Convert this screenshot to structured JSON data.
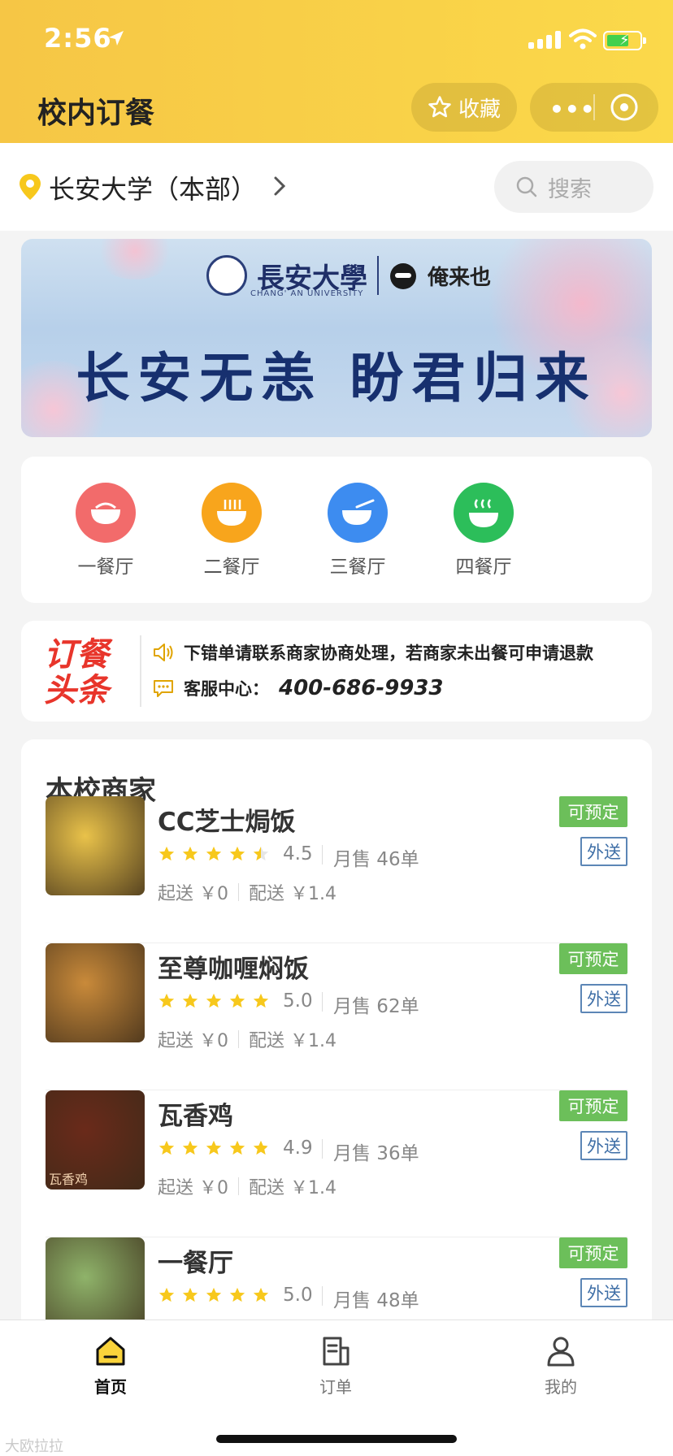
{
  "status_bar": {
    "time": "2:56"
  },
  "header": {
    "title": "校内订餐",
    "favorite_label": "收藏",
    "more_label": "•••"
  },
  "location": {
    "campus": "长安大学（本部）",
    "search_placeholder": "搜索"
  },
  "banner": {
    "university": "長安大學",
    "university_en": "CHANG' AN UNIVERSITY",
    "brand": "俺来也",
    "headline": "长安无恙 盼君归来"
  },
  "canteens": [
    {
      "label": "一餐厅",
      "color": "#f26b6b",
      "icon": "rice-bowl-icon"
    },
    {
      "label": "二餐厅",
      "color": "#f8a51c",
      "icon": "noodle-bowl-icon"
    },
    {
      "label": "三餐厅",
      "color": "#3d8cf0",
      "icon": "soup-bowl-icon"
    },
    {
      "label": "四餐厅",
      "color": "#2cbe5a",
      "icon": "hot-bowl-icon"
    }
  ],
  "notice": {
    "badge_line1": "订餐",
    "badge_line2": "头条",
    "message": "下错单请联系商家协商处理，若商家未出餐可申请退款",
    "service_label": "客服中心：",
    "service_phone": "400-686-9933"
  },
  "merchants": {
    "title": "本校商家",
    "shops": [
      {
        "name": "CC芝士焗饭",
        "rating": "4.5",
        "rating_value": 4.5,
        "sales": "月售 46单",
        "min_order": "起送 ￥0",
        "delivery_fee": "配送 ￥1.4",
        "tag_reserve": "可预定",
        "tag_delivery": "外送",
        "thumb_color": "#e9c24a"
      },
      {
        "name": "至尊咖喱焖饭",
        "rating": "5.0",
        "rating_value": 5.0,
        "sales": "月售 62单",
        "min_order": "起送 ￥0",
        "delivery_fee": "配送 ￥1.4",
        "tag_reserve": "可预定",
        "tag_delivery": "外送",
        "thumb_color": "#c98a3a"
      },
      {
        "name": "瓦香鸡",
        "rating": "4.9",
        "rating_value": 4.9,
        "sales": "月售 36单",
        "min_order": "起送 ￥0",
        "delivery_fee": "配送 ￥1.4",
        "tag_reserve": "可预定",
        "tag_delivery": "外送",
        "thumb_color": "#6a2a1a",
        "thumb_caption": "瓦香鸡"
      },
      {
        "name": "一餐厅",
        "rating": "5.0",
        "rating_value": 5.0,
        "sales": "月售 48单",
        "min_order": "",
        "delivery_fee": "",
        "tag_reserve": "可预定",
        "tag_delivery": "外送",
        "thumb_color": "#8fb36a"
      }
    ]
  },
  "tabbar": {
    "tabs": [
      {
        "label": "首页",
        "active": true
      },
      {
        "label": "订单",
        "active": false
      },
      {
        "label": "我的",
        "active": false
      }
    ]
  },
  "watermark": "大欧拉拉"
}
